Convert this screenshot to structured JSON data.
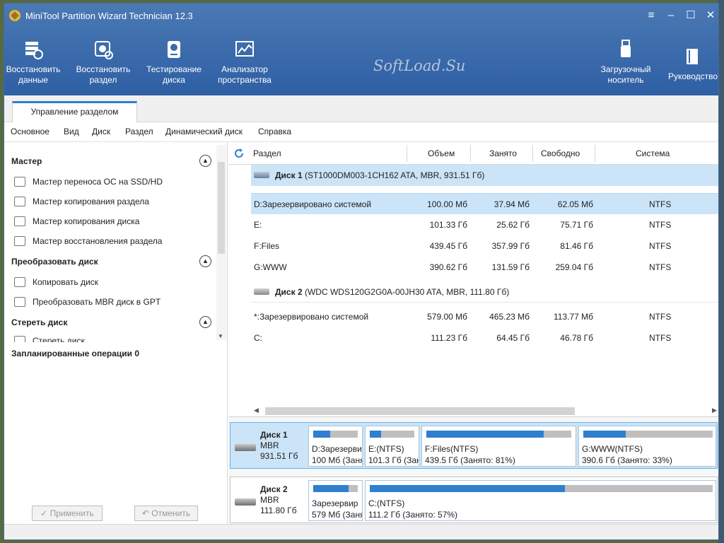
{
  "app": {
    "title": "MiniTool Partition Wizard Technician 12.3",
    "watermark": "SoftLoad.Su",
    "accent_color": "#2f7fd0",
    "header_color": "#3a6aab"
  },
  "window_controls": {
    "menu_icon": "hamburger-icon",
    "minimize_icon": "minimize-icon",
    "maximize_icon": "maximize-icon",
    "close_icon": "close-icon"
  },
  "toolbar": {
    "tools": [
      {
        "label": "Восстановить\nданные",
        "icon": "data-recovery-icon"
      },
      {
        "label": "Восстановить\nраздел",
        "icon": "partition-recovery-icon"
      },
      {
        "label": "Тестирование\nдиска",
        "icon": "disk-benchmark-icon"
      },
      {
        "label": "Анализатор\nпространства",
        "icon": "space-analyzer-icon"
      }
    ],
    "right_tools": [
      {
        "label": "Загрузочный\nноситель",
        "icon": "bootable-media-icon"
      },
      {
        "label": "Руководство",
        "icon": "manual-icon"
      }
    ]
  },
  "tab": {
    "label": "Управление разделом"
  },
  "menu": [
    "Основное",
    "Вид",
    "Диск",
    "Раздел",
    "Динамический диск",
    "Справка"
  ],
  "sidebar": {
    "sections": [
      {
        "title": "Мастер",
        "items": [
          "Мастер переноса ОС на SSD/HD",
          "Мастер копирования раздела",
          "Мастер копирования диска",
          "Мастер восстановления раздела"
        ]
      },
      {
        "title": "Преобразовать диск",
        "items": [
          "Копировать диск",
          "Преобразовать MBR диск в GPT"
        ]
      },
      {
        "title": "Стереть диск",
        "items": [
          "Стереть диск"
        ]
      }
    ],
    "pending": "Запланированные операции 0",
    "apply_label": "✓ Применить",
    "undo_label": "↶ Отменить"
  },
  "table": {
    "columns": [
      "Раздел",
      "Объем",
      "Занято",
      "Свободно",
      "Система"
    ],
    "disks": [
      {
        "name": "Диск 1",
        "info": "(ST1000DM003-1CH162 ATA, MBR, 931.51 Гб)",
        "partitions": [
          {
            "name": "D:Зарезервировано системой",
            "size": "100.00 Мб",
            "used": "37.94 Мб",
            "free": "62.05 Мб",
            "fs": "NTFS",
            "selected": true
          },
          {
            "name": "E:",
            "size": "101.33 Гб",
            "used": "25.62 Гб",
            "free": "75.71 Гб",
            "fs": "NTFS"
          },
          {
            "name": "F:Files",
            "size": "439.45 Гб",
            "used": "357.99 Гб",
            "free": "81.46 Гб",
            "fs": "NTFS"
          },
          {
            "name": "G:WWW",
            "size": "390.62 Гб",
            "used": "131.59 Гб",
            "free": "259.04 Гб",
            "fs": "NTFS"
          }
        ]
      },
      {
        "name": "Диск 2",
        "info": "(WDC WDS120G2G0A-00JH30 ATA, MBR, 111.80 Гб)",
        "partitions": [
          {
            "name": "*:Зарезервировано системой",
            "size": "579.00 Мб",
            "used": "465.23 Мб",
            "free": "113.77 Мб",
            "fs": "NTFS"
          },
          {
            "name": "C:",
            "size": "111.23 Гб",
            "used": "64.45 Гб",
            "free": "46.78 Гб",
            "fs": "NTFS"
          }
        ]
      }
    ]
  },
  "diskmap": [
    {
      "name": "Диск 1",
      "type": "MBR",
      "size": "931.51 Гб",
      "selected": true,
      "parts": [
        {
          "label": "D:Зарезерви",
          "size": "100 Мб (Заня",
          "used_fraction": 0.38
        },
        {
          "label": "E:(NTFS)",
          "size": "101.3 Гб (Зан",
          "used_fraction": 0.25
        },
        {
          "label": "F:Files(NTFS)",
          "size": "439.5 Гб (Занято: 81%)",
          "used_fraction": 0.81
        },
        {
          "label": "G:WWW(NTFS)",
          "size": "390.6 Гб (Занято: 33%)",
          "used_fraction": 0.33
        }
      ]
    },
    {
      "name": "Диск 2",
      "type": "MBR",
      "size": "111.80 Гб",
      "selected": false,
      "parts": [
        {
          "label": "Зарезервир",
          "size": "579 Мб (Заня",
          "used_fraction": 0.8
        },
        {
          "label": "C:(NTFS)",
          "size": "111.2 Гб (Занято: 57%)",
          "used_fraction": 0.57
        }
      ]
    }
  ]
}
